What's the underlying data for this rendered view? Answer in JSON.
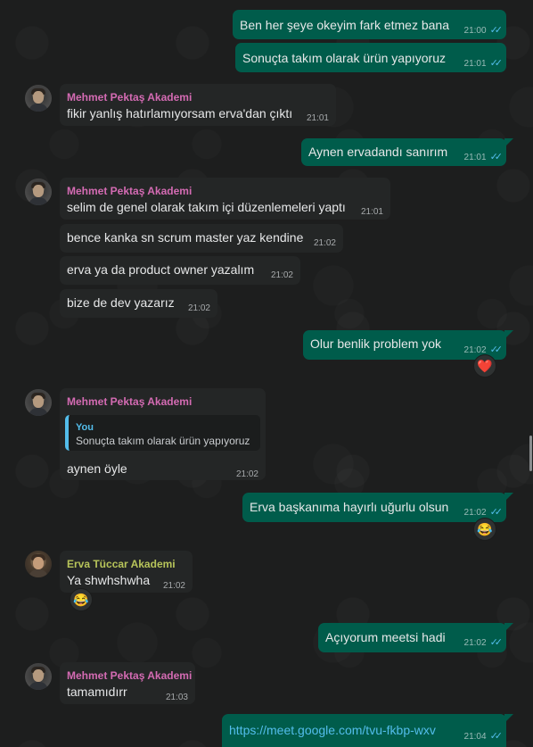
{
  "colors": {
    "outgoing_bubble": "#005c4b",
    "incoming_bubble": "#242626",
    "sender_mehmet": "#d46bb3",
    "sender_erva": "#b7c45a",
    "read_ticks": "#53bdeb"
  },
  "messages": {
    "m1": {
      "text": "Ben her şeye okeyim fark etmez bana",
      "time": "21:00"
    },
    "m2": {
      "text": "Sonuçta takım olarak ürün yapıyoruz",
      "time": "21:01"
    },
    "m3": {
      "sender": "Mehmet Pektaş Akademi",
      "text": "fikir yanlış hatırlamıyorsam erva'dan çıktı",
      "time": "21:01"
    },
    "m4": {
      "text": "Aynen ervadandı sanırım",
      "time": "21:01"
    },
    "m5": {
      "sender": "Mehmet Pektaş Akademi",
      "text": "selim de genel olarak takım içi düzenlemeleri yaptı",
      "time": "21:01"
    },
    "m6": {
      "text": "bence kanka sn scrum master yaz kendine",
      "time": "21:02"
    },
    "m7": {
      "text": "erva ya da product owner yazalım",
      "time": "21:02"
    },
    "m8": {
      "text": "bize de dev yazarız",
      "time": "21:02"
    },
    "m9": {
      "text": "Olur benlik problem yok",
      "time": "21:02",
      "reaction": "❤️"
    },
    "m10": {
      "sender": "Mehmet Pektaş Akademi",
      "quote_author": "You",
      "quote_text": "Sonuçta takım olarak ürün yapıyoruz",
      "text": "aynen öyle",
      "time": "21:02"
    },
    "m11": {
      "text": "Erva başkanıma hayırlı uğurlu olsun",
      "time": "21:02",
      "reaction": "😂"
    },
    "m12": {
      "sender": "Erva Tüccar Akademi",
      "text": "Ya shwhshwha",
      "time": "21:02",
      "reaction": "😂"
    },
    "m13": {
      "text": "Açıyorum meetsi hadi",
      "time": "21:02"
    },
    "m14": {
      "sender": "Mehmet Pektaş Akademi",
      "text": "tamamıdırr",
      "time": "21:03"
    },
    "m15": {
      "text": "https://meet.google.com/tvu-fkbp-wxv",
      "time": "21:04"
    }
  },
  "icons": {
    "read": "double-check-icon"
  }
}
